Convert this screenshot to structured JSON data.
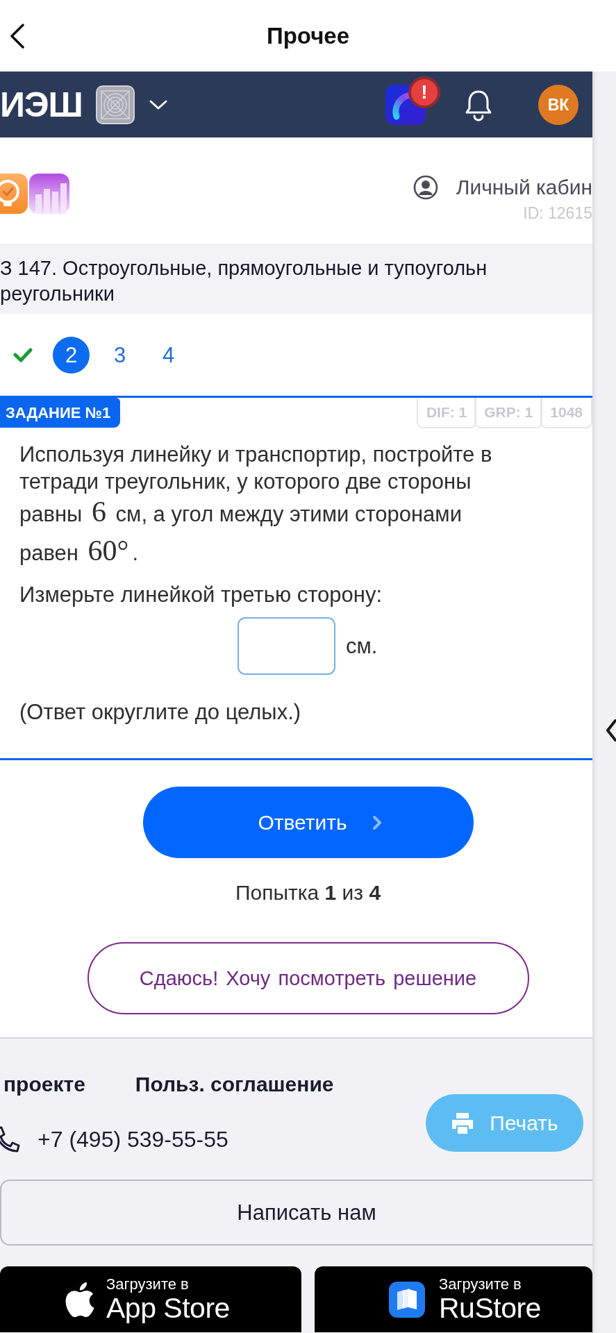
{
  "nav": {
    "title": "Прочее"
  },
  "header": {
    "logo": "ИЭШ",
    "alert_badge": "!",
    "avatar": "ВК"
  },
  "account": {
    "label": "Личный кабин",
    "id": "ID: 12615"
  },
  "lesson_title_lines": [
    "З 147. Остроугольные, прямоугольные и тупоугольн",
    "реугольники"
  ],
  "steps": [
    {
      "kind": "done",
      "selected": false
    },
    {
      "kind": "number",
      "label": "2",
      "selected": true
    },
    {
      "kind": "number",
      "label": "3",
      "selected": false
    },
    {
      "kind": "number",
      "label": "4",
      "selected": false
    }
  ],
  "task": {
    "badge": "ЗАДАНИЕ №1",
    "tags": [
      "DIF: 1",
      "GRP: 1",
      "1048"
    ],
    "text_lines": [
      [
        {
          "kind": "text",
          "text": "Используя линейку и транспортир, постройте в"
        }
      ],
      [
        {
          "kind": "text",
          "text": "тетради треугольник, у которого две стороны"
        }
      ],
      [
        {
          "kind": "text",
          "text": "равны "
        },
        {
          "kind": "math",
          "text": "6"
        },
        {
          "kind": "text",
          "text": " см, а угол между этими сторонами"
        }
      ],
      [
        {
          "kind": "text",
          "text": "равен "
        },
        {
          "kind": "math",
          "text": "60°"
        },
        {
          "kind": "text",
          "text": "."
        }
      ]
    ],
    "question": "Измерьте линейкой третью сторону:",
    "unit": "см.",
    "note": "(Ответ округлите до целых.)"
  },
  "submit_button": "Ответить",
  "attempt": "Попытка **1** из **4**",
  "give_up_button": "Сдаюсь! Хочу посмотреть решение",
  "footer": {
    "links": [
      "проекте",
      "Польз. соглашение"
    ],
    "phone": "+7 (495) 539-55-55",
    "print_button": "Печать",
    "contact_button": "Написать нам",
    "stores": [
      {
        "kind": "apple",
        "caption": "Загрузите в",
        "name": "App Store"
      },
      {
        "kind": "rustore",
        "caption": "Загрузите в",
        "name": "RuStore"
      }
    ]
  }
}
